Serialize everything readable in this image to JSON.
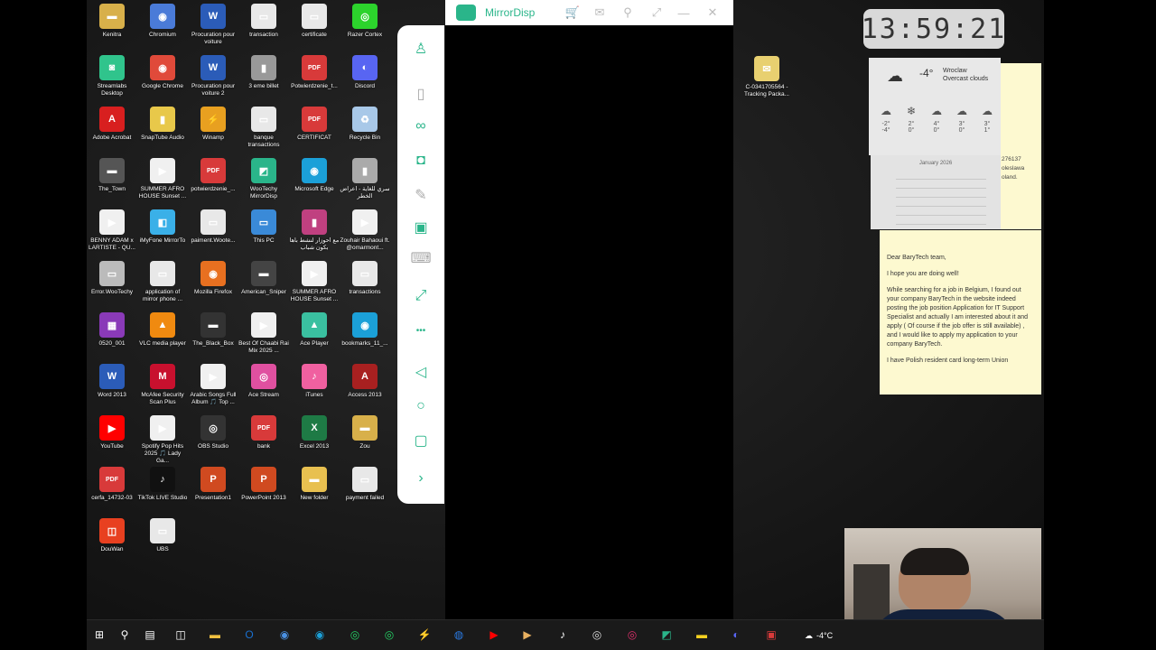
{
  "desktop": {
    "icons": [
      {
        "label": "Kenitra",
        "icon": "folder-icon",
        "color": "#d8b04a",
        "glyph": "▬"
      },
      {
        "label": "Chromium",
        "icon": "chromium-icon",
        "color": "#4a7bd8",
        "glyph": "◉"
      },
      {
        "label": "Procuration pour voiture",
        "icon": "word-doc-icon",
        "color": "#2b5cb8",
        "glyph": "W"
      },
      {
        "label": "transaction",
        "icon": "document-icon",
        "color": "#e8e8e8",
        "glyph": "▭"
      },
      {
        "label": "certificate",
        "icon": "document-icon",
        "color": "#e8e8e8",
        "glyph": "▭"
      },
      {
        "label": "Razer Cortex",
        "icon": "razer-icon",
        "color": "#2cd32c",
        "glyph": "◎"
      },
      {
        "label": "Streamlabs Desktop",
        "icon": "streamlabs-icon",
        "color": "#30c48c",
        "glyph": "◙"
      },
      {
        "label": "Google Chrome",
        "icon": "chrome-icon",
        "color": "#e04a3a",
        "glyph": "◉"
      },
      {
        "label": "Procuration pour voiture 2",
        "icon": "word-doc-icon",
        "color": "#2b5cb8",
        "glyph": "W"
      },
      {
        "label": "3 eme billet",
        "icon": "image-icon",
        "color": "#999999",
        "glyph": "▮"
      },
      {
        "label": "Potwierdzenie_t...",
        "icon": "pdf-icon",
        "color": "#d83a3a",
        "glyph": "PDF"
      },
      {
        "label": "Discord",
        "icon": "discord-icon",
        "color": "#5865f2",
        "glyph": "◐"
      },
      {
        "label": "Adobe Acrobat",
        "icon": "acrobat-icon",
        "color": "#d81f1f",
        "glyph": "A"
      },
      {
        "label": "SnapTube Audio",
        "icon": "snaptube-icon",
        "color": "#e8c84a",
        "glyph": "▮"
      },
      {
        "label": "Winamp",
        "icon": "winamp-icon",
        "color": "#e8a020",
        "glyph": "⚡"
      },
      {
        "label": "banque transactions",
        "icon": "document-icon",
        "color": "#e8e8e8",
        "glyph": "▭"
      },
      {
        "label": "CERTIFICAT",
        "icon": "pdf-icon",
        "color": "#d83a3a",
        "glyph": "PDF"
      },
      {
        "label": "Recycle Bin",
        "icon": "recycle-bin-icon",
        "color": "#a8c8e8",
        "glyph": "♻"
      },
      {
        "label": "The_Town",
        "icon": "video-thumbnail-icon",
        "color": "#555555",
        "glyph": "▬"
      },
      {
        "label": "SUMMER AFRO HOUSE Sunset ...",
        "icon": "media-file-icon",
        "color": "#f0f0f0",
        "glyph": "▶"
      },
      {
        "label": "potwierdzenie_...",
        "icon": "pdf-icon",
        "color": "#d83a3a",
        "glyph": "PDF"
      },
      {
        "label": "WooTechy MirrorDisp",
        "icon": "mirrordisp-icon",
        "color": "#2ab58a",
        "glyph": "◩"
      },
      {
        "label": "Microsoft Edge",
        "icon": "edge-icon",
        "color": "#1ba0d8",
        "glyph": "◉"
      },
      {
        "label": "سري للغاية - أعراض الخطر",
        "icon": "image-icon",
        "color": "#aaaaaa",
        "glyph": "▮"
      },
      {
        "label": "BENNY ADAM x LARTISTE - QU...",
        "icon": "media-file-icon",
        "color": "#f0f0f0",
        "glyph": "▶"
      },
      {
        "label": "iMyFone MirrorTo",
        "icon": "imyfone-icon",
        "color": "#3ab0e8",
        "glyph": "◧"
      },
      {
        "label": "paiment.Woote...",
        "icon": "document-icon",
        "color": "#e8e8e8",
        "glyph": "▭"
      },
      {
        "label": "This PC",
        "icon": "this-pc-icon",
        "color": "#3a8ad8",
        "glyph": "▭"
      },
      {
        "label": "مع أحوزار لنشط باها بكون شباب",
        "icon": "image-icon",
        "color": "#c04080",
        "glyph": "▮"
      },
      {
        "label": "Zouhair Bahaoui ft. @omarmont...",
        "icon": "media-file-icon",
        "color": "#f0f0f0",
        "glyph": "▶"
      },
      {
        "label": "Error.WooTechy",
        "icon": "document-icon",
        "color": "#bbbbbb",
        "glyph": "▭"
      },
      {
        "label": "application of mirror phone ...",
        "icon": "document-icon",
        "color": "#e8e8e8",
        "glyph": "▭"
      },
      {
        "label": "Mozilla Firefox",
        "icon": "firefox-icon",
        "color": "#e87020",
        "glyph": "◉"
      },
      {
        "label": "American_Sniper",
        "icon": "video-thumbnail-icon",
        "color": "#444444",
        "glyph": "▬"
      },
      {
        "label": "SUMMER AFRO HOUSE Sunset ...",
        "icon": "media-file-icon",
        "color": "#f0f0f0",
        "glyph": "▶"
      },
      {
        "label": "transactions",
        "icon": "document-icon",
        "color": "#e8e8e8",
        "glyph": "▭"
      },
      {
        "label": "0520_001",
        "icon": "archive-icon",
        "color": "#8a3ab8",
        "glyph": "▦"
      },
      {
        "label": "VLC media player",
        "icon": "vlc-icon",
        "color": "#f08a10",
        "glyph": "▲"
      },
      {
        "label": "The_Black_Box",
        "icon": "video-thumbnail-icon",
        "color": "#333333",
        "glyph": "▬"
      },
      {
        "label": "Best Of Chaabi Rai Mix 2025 ...",
        "icon": "media-file-icon",
        "color": "#f0f0f0",
        "glyph": "▶"
      },
      {
        "label": "Ace Player",
        "icon": "ace-player-icon",
        "color": "#3ac0a0",
        "glyph": "▲"
      },
      {
        "label": "bookmarks_11_...",
        "icon": "edge-icon",
        "color": "#1ba0d8",
        "glyph": "◉"
      },
      {
        "label": "Word 2013",
        "icon": "word-icon",
        "color": "#2b5cb8",
        "glyph": "W"
      },
      {
        "label": "McAfee Security Scan Plus",
        "icon": "mcafee-icon",
        "color": "#c8102e",
        "glyph": "M"
      },
      {
        "label": "Arabic Songs Full Album 🎵 Top ...",
        "icon": "media-file-icon",
        "color": "#f0f0f0",
        "glyph": "▶"
      },
      {
        "label": "Ace Stream",
        "icon": "ace-stream-icon",
        "color": "#e050a0",
        "glyph": "◎"
      },
      {
        "label": "iTunes",
        "icon": "itunes-icon",
        "color": "#f060a0",
        "glyph": "♪"
      },
      {
        "label": "Access 2013",
        "icon": "access-icon",
        "color": "#a82020",
        "glyph": "A"
      },
      {
        "label": "YouTube",
        "icon": "youtube-icon",
        "color": "#ff0000",
        "glyph": "▶"
      },
      {
        "label": "Spotify Pop Hits 2025 🎵 Lady Ga...",
        "icon": "media-file-icon",
        "color": "#f0f0f0",
        "glyph": "▶"
      },
      {
        "label": "OBS Studio",
        "icon": "obs-icon",
        "color": "#333333",
        "glyph": "◎"
      },
      {
        "label": "bank",
        "icon": "pdf-icon",
        "color": "#d83a3a",
        "glyph": "PDF"
      },
      {
        "label": "Excel 2013",
        "icon": "excel-icon",
        "color": "#1e7a45",
        "glyph": "X"
      },
      {
        "label": "Zou",
        "icon": "folder-icon",
        "color": "#d8b04a",
        "glyph": "▬"
      },
      {
        "label": "cerfa_14732-03",
        "icon": "pdf-icon",
        "color": "#d83a3a",
        "glyph": "PDF"
      },
      {
        "label": "TikTok LIVE Studio",
        "icon": "tiktok-icon",
        "color": "#111111",
        "glyph": "♪"
      },
      {
        "label": "Presentation1",
        "icon": "powerpoint-doc-icon",
        "color": "#d04a20",
        "glyph": "P"
      },
      {
        "label": "PowerPoint 2013",
        "icon": "powerpoint-icon",
        "color": "#d04a20",
        "glyph": "P"
      },
      {
        "label": "New folder",
        "icon": "folder-icon",
        "color": "#e8c050",
        "glyph": "▬"
      },
      {
        "label": "payment failed",
        "icon": "document-icon",
        "color": "#e8e8e8",
        "glyph": "▭"
      },
      {
        "label": "DouWan",
        "icon": "douwan-icon",
        "color": "#e84020",
        "glyph": "◫"
      },
      {
        "label": "UBS",
        "icon": "document-icon",
        "color": "#e8e8e8",
        "glyph": "▭"
      },
      {
        "label": "C-0341705564 - Tracking Packa...",
        "icon": "envelope-icon",
        "color": "#e8d070",
        "glyph": "✉"
      }
    ]
  },
  "mirror": {
    "app_name": "MirrorDisp",
    "side_tools": [
      {
        "name": "account-icon",
        "glyph": "♙"
      },
      {
        "name": "mouse-icon",
        "glyph": "▯"
      },
      {
        "name": "infinity-icon",
        "glyph": "∞"
      },
      {
        "name": "camera-icon",
        "glyph": "◘"
      },
      {
        "name": "draw-icon",
        "glyph": "✎"
      },
      {
        "name": "record-icon",
        "glyph": "▣"
      },
      {
        "name": "keyboard-icon",
        "glyph": "⌨"
      },
      {
        "name": "expand-icon",
        "glyph": "⤢"
      },
      {
        "name": "more-icon",
        "glyph": "•••"
      },
      {
        "name": "back-icon",
        "glyph": "◁"
      },
      {
        "name": "home-icon",
        "glyph": "○"
      },
      {
        "name": "recent-apps-icon",
        "glyph": "▢"
      },
      {
        "name": "collapse-arrow-icon",
        "glyph": "›"
      }
    ],
    "title_buttons": [
      {
        "name": "cart-icon",
        "glyph": "🛒"
      },
      {
        "name": "mail-icon",
        "glyph": "✉"
      },
      {
        "name": "pin-icon",
        "glyph": "⚲"
      },
      {
        "name": "resize-icon",
        "glyph": "⤢"
      },
      {
        "name": "minimize-icon",
        "glyph": "—"
      },
      {
        "name": "close-icon",
        "glyph": "✕"
      }
    ]
  },
  "clock": {
    "time": "13:59:21"
  },
  "weather": {
    "city": "Wroclaw",
    "temp": "-4°",
    "condition": "Overcast clouds",
    "days": [
      {
        "hi": "-2°",
        "lo": "-4°"
      },
      {
        "hi": "2°",
        "lo": "0°"
      },
      {
        "hi": "4°",
        "lo": "0°"
      },
      {
        "hi": "3°",
        "lo": "0°"
      },
      {
        "hi": "3°",
        "lo": "1°"
      }
    ]
  },
  "calendar": {
    "month": "January 2026"
  },
  "sticky_side": {
    "lines": [
      "276137",
      "oleslawa",
      "oland."
    ]
  },
  "sticky_letter": {
    "greeting": "Dear BaryTech team,",
    "line1": "I hope you are doing well!",
    "body": "While searching for a job in Belgium, I found out your company BaryTech in the website indeed posting the job position Application for IT Support Specialist and actually I am interested about it and apply ( Of course if the job offer is still available) , and I would like to apply my application to your company BaryTech.",
    "line3": "I have Polish resident card long-term Union"
  },
  "taskbar": {
    "apps": [
      {
        "name": "start-icon",
        "glyph": "⊞",
        "color": "#ffffff"
      },
      {
        "name": "search-icon",
        "glyph": "⚲",
        "color": "#ffffff"
      },
      {
        "name": "task-view-icon",
        "glyph": "▤",
        "color": "#ffffff"
      },
      {
        "name": "store-icon",
        "glyph": "◫",
        "color": "#ffffff"
      },
      {
        "name": "file-explorer-icon",
        "glyph": "▬",
        "color": "#f0c040"
      },
      {
        "name": "outlook-icon",
        "glyph": "O",
        "color": "#1a70d0"
      },
      {
        "name": "chrome-icon",
        "glyph": "◉",
        "color": "#4a90e2"
      },
      {
        "name": "edge-icon",
        "glyph": "◉",
        "color": "#1ba0d8"
      },
      {
        "name": "whatsapp-icon",
        "glyph": "◎",
        "color": "#25d366"
      },
      {
        "name": "whatsapp-business-icon",
        "glyph": "◎",
        "color": "#25d366"
      },
      {
        "name": "winamp-icon",
        "glyph": "⚡",
        "color": "#e8a020"
      },
      {
        "name": "messenger-icon",
        "glyph": "◍",
        "color": "#2a7ae2"
      },
      {
        "name": "youtube-icon",
        "glyph": "▶",
        "color": "#ff0000"
      },
      {
        "name": "media-player-icon",
        "glyph": "▶",
        "color": "#e8b060"
      },
      {
        "name": "tiktok-icon",
        "glyph": "♪",
        "color": "#ffffff"
      },
      {
        "name": "razer-icon",
        "glyph": "◎",
        "color": "#dddddd"
      },
      {
        "name": "instagram-icon",
        "glyph": "◎",
        "color": "#e1306c"
      },
      {
        "name": "mirrordisp-icon",
        "glyph": "◩",
        "color": "#2ab58a"
      },
      {
        "name": "sticky-notes-icon",
        "glyph": "▬",
        "color": "#f5d020"
      },
      {
        "name": "discord-icon",
        "glyph": "◐",
        "color": "#5865f2"
      },
      {
        "name": "pdf-reader-icon",
        "glyph": "▣",
        "color": "#d83a3a"
      }
    ],
    "weather_temp": "-4°C"
  }
}
